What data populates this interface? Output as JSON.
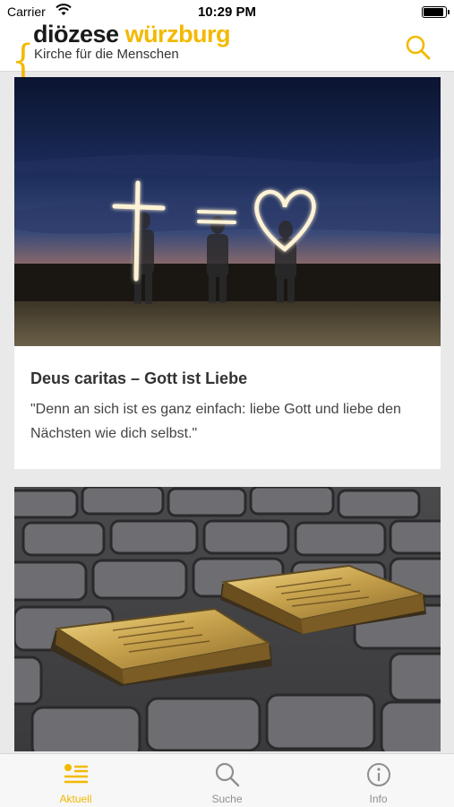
{
  "status_bar": {
    "carrier": "Carrier",
    "time": "10:29 PM",
    "battery_level": 0.95
  },
  "header": {
    "logo_dark": "diözese",
    "logo_accent": "würzburg",
    "subtitle": "Kirche für die Menschen",
    "search_icon": "search-icon",
    "accent_color": "#f3b900"
  },
  "feed": {
    "cards": [
      {
        "title": "Deus caritas – Gott ist Liebe",
        "text": "\"Denn an sich ist es ganz einfach: liebe Gott und liebe den Nächsten wie dich selbst.\""
      }
    ]
  },
  "tabbar": {
    "tabs": [
      {
        "label": "Aktuell",
        "icon": "news-list-icon",
        "active": true
      },
      {
        "label": "Suche",
        "icon": "search-icon",
        "active": false
      },
      {
        "label": "Info",
        "icon": "info-icon",
        "active": false
      }
    ]
  }
}
